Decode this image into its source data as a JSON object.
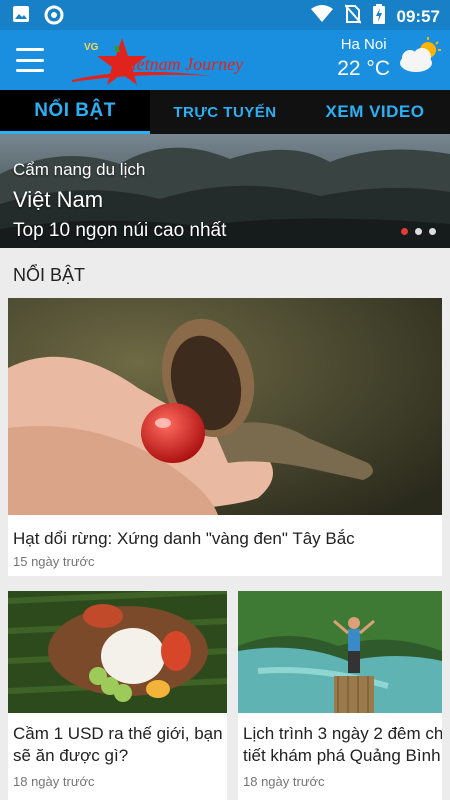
{
  "status_bar": {
    "time": "09:57",
    "icons": [
      "gallery-icon",
      "sync-icon",
      "wifi-icon",
      "no-sim-icon",
      "battery-charging-icon"
    ]
  },
  "app_bar": {
    "logo_text": "Vietnam Journey",
    "weather": {
      "city": "Ha Noi",
      "temperature": "22 °C",
      "icon": "partly-cloudy-icon"
    }
  },
  "tabs": [
    {
      "label": "NỔI BẬT",
      "active": true
    },
    {
      "label": "TRỰC TUYẾN",
      "active": false
    },
    {
      "label": "XEM VIDEO",
      "active": false
    }
  ],
  "hero": {
    "line1": "Cẩm nang du lịch",
    "line2": "Việt Nam",
    "line3": "Top 10 ngọn núi cao nhất",
    "slides": 3,
    "active_slide": 1
  },
  "section": {
    "title": "NỔI BẬT"
  },
  "articles": [
    {
      "title": "Hạt dổi rừng: Xứng danh \"vàng đen\" Tây Bắc",
      "time": "15 ngày trước"
    },
    {
      "title_line1": "Cầm 1 USD ra thế giới, bạn",
      "title_line2": "sẽ ăn được gì?",
      "time": "18 ngày trước"
    },
    {
      "title_line1": "Lịch trình 3 ngày 2 đêm ch",
      "title_line2": "tiết khám phá Quảng Bình",
      "time": "18 ngày trước"
    }
  ]
}
